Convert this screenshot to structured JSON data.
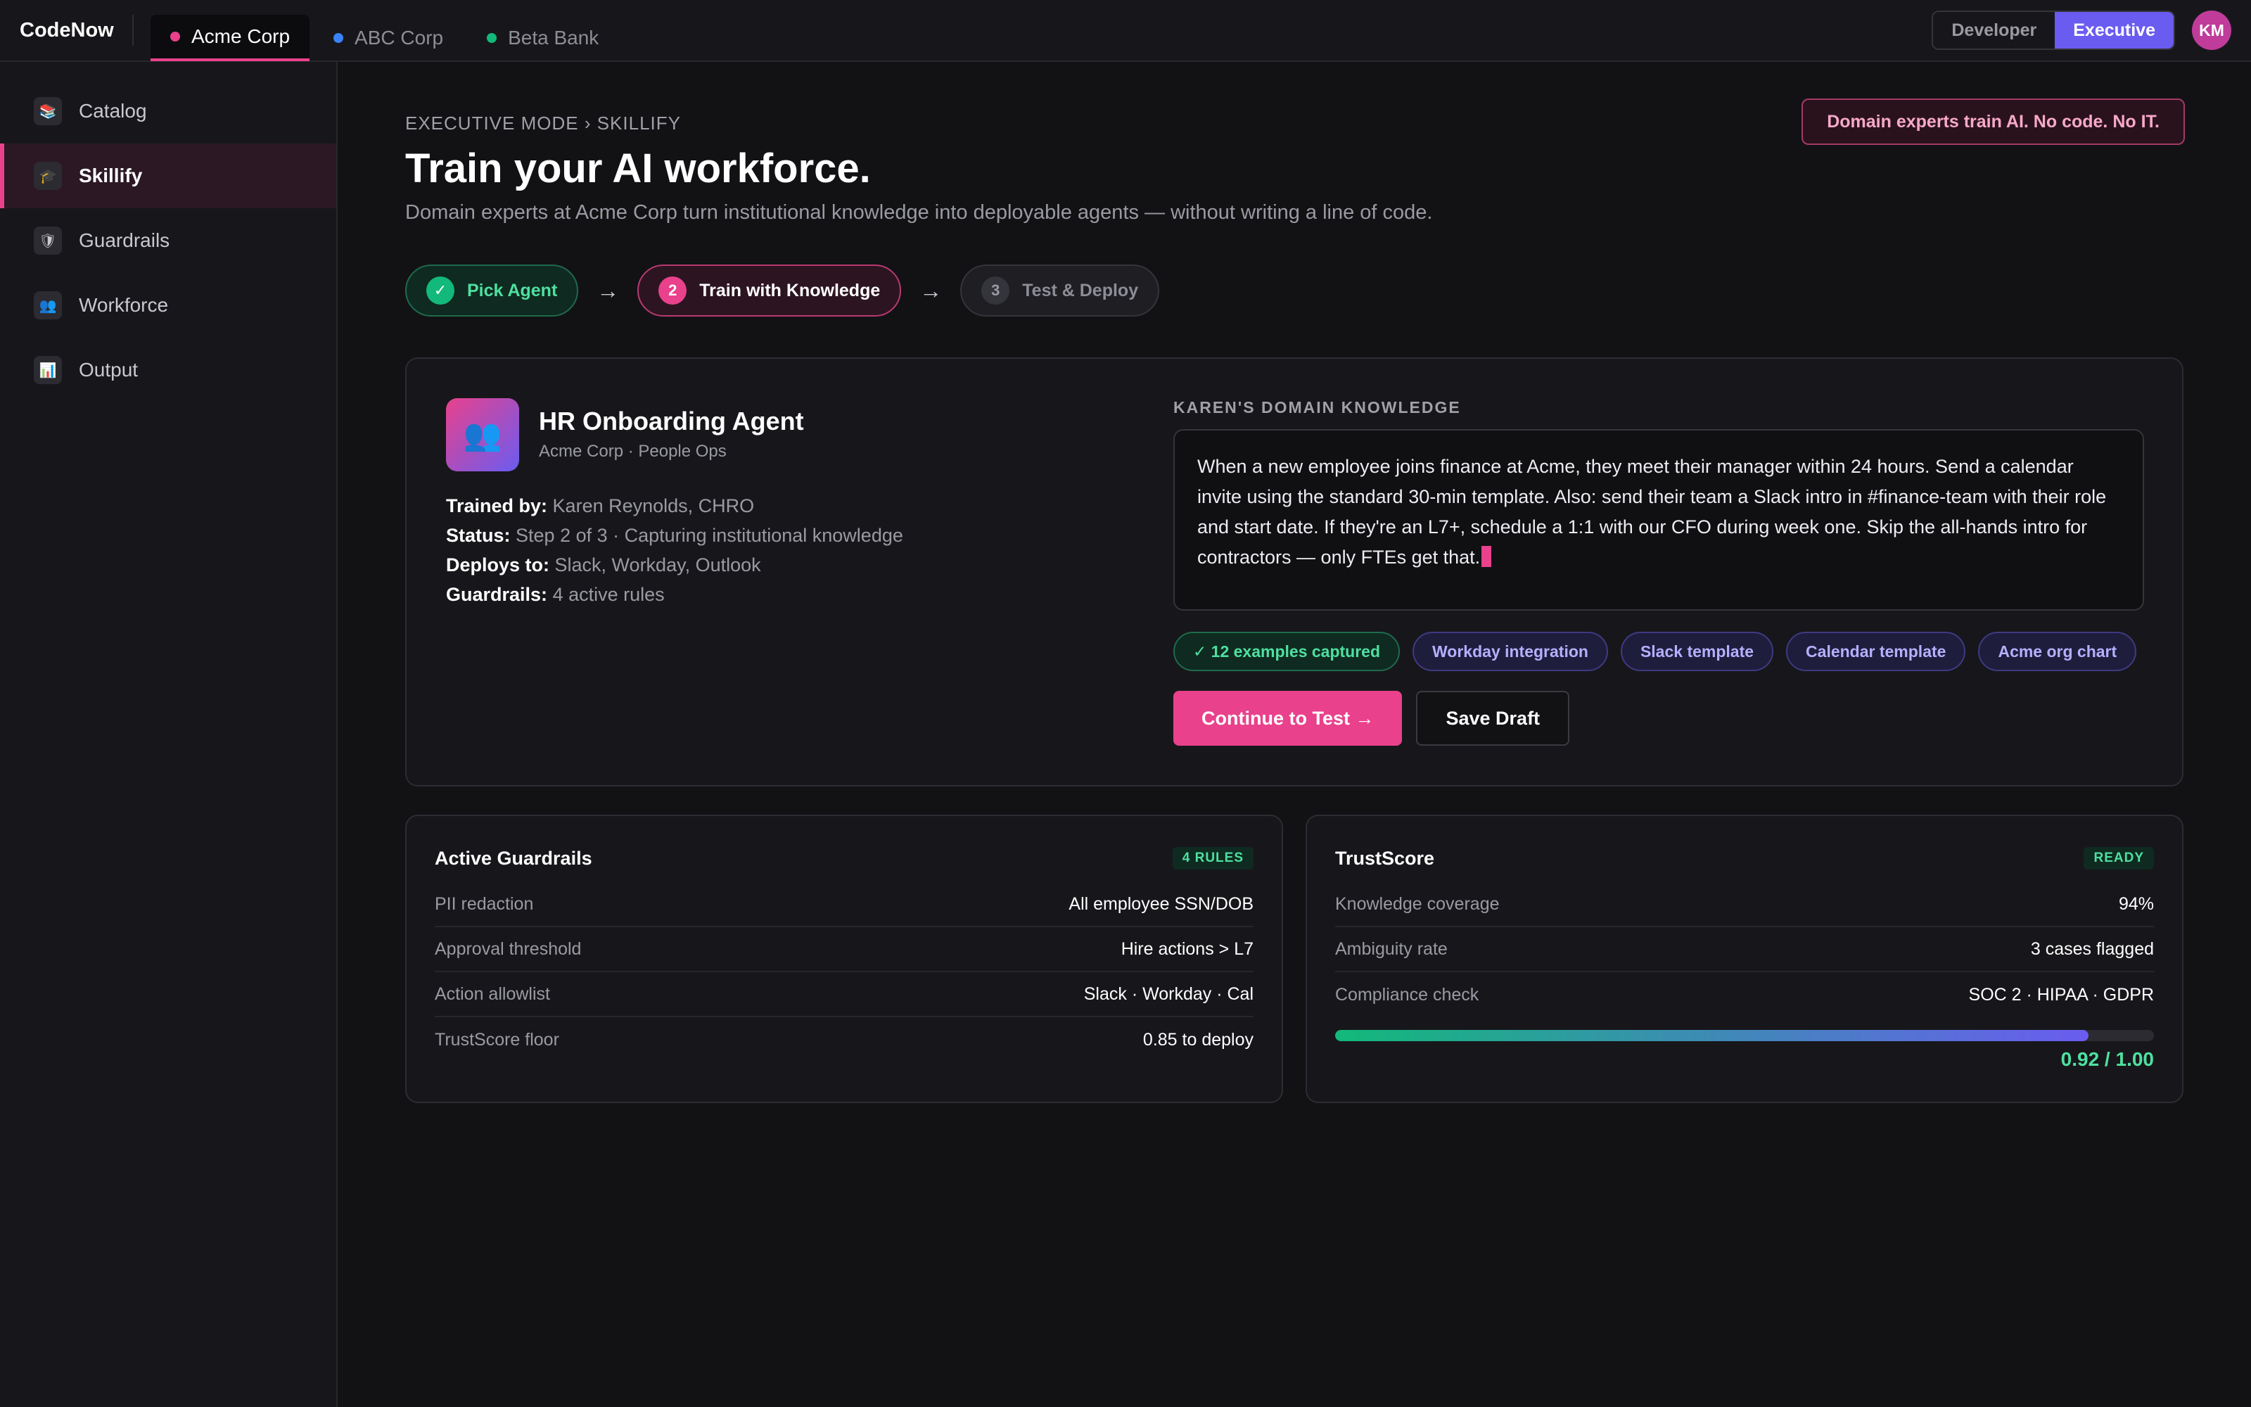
{
  "app": {
    "logo": "CodeNow"
  },
  "tenants": [
    {
      "label": "Acme Corp",
      "color": "#e9418c",
      "active": true
    },
    {
      "label": "ABC Corp",
      "color": "#3b82f6",
      "active": false
    },
    {
      "label": "Beta Bank",
      "color": "#12b97a",
      "active": false
    }
  ],
  "mode": {
    "developer": "Developer",
    "executive": "Executive",
    "selected": "Executive"
  },
  "user": {
    "initials": "KM"
  },
  "sidebar": {
    "items": [
      {
        "label": "Catalog",
        "icon": "books-icon",
        "glyph": "📚",
        "active": false
      },
      {
        "label": "Skillify",
        "icon": "graduation-cap-icon",
        "glyph": "🎓",
        "active": true
      },
      {
        "label": "Guardrails",
        "icon": "shield-icon",
        "glyph": "🛡",
        "active": false
      },
      {
        "label": "Workforce",
        "icon": "people-icon",
        "glyph": "👥",
        "active": false
      },
      {
        "label": "Output",
        "icon": "chart-icon",
        "glyph": "📊",
        "active": false
      }
    ]
  },
  "header": {
    "breadcrumb": "EXECUTIVE MODE › SKILLIFY",
    "title": "Train your AI workforce.",
    "subtitle": "Domain experts at Acme Corp turn institutional knowledge into deployable agents — without writing a line of code.",
    "banner": "Domain experts train AI. No code. No IT."
  },
  "steps": [
    {
      "num": "✓",
      "label": "Pick Agent",
      "state": "done"
    },
    {
      "num": "2",
      "label": "Train with Knowledge",
      "state": "current"
    },
    {
      "num": "3",
      "label": "Test & Deploy",
      "state": "todo"
    }
  ],
  "step_arrow": "→",
  "agent": {
    "glyph": "👥",
    "name": "HR Onboarding Agent",
    "org": "Acme Corp · People Ops",
    "trained_by_label": "Trained by:",
    "trained_by": "Karen Reynolds, CHRO",
    "status_label": "Status:",
    "status": "Step 2 of 3 · Capturing institutional knowledge",
    "deploys_label": "Deploys to:",
    "deploys": "Slack, Workday, Outlook",
    "guardrails_label": "Guardrails:",
    "guardrails": "4 active rules"
  },
  "knowledge": {
    "label": "KAREN'S DOMAIN KNOWLEDGE",
    "text": "When a new employee joins finance at Acme, they meet their manager within 24 hours. Send a calendar invite using the standard 30-min template. Also: send their team a Slack intro in #finance-team with their role and start date. If they're an L7+, schedule a 1:1 with our CFO during week one. Skip the all-hands intro for contractors — only FTEs get that.",
    "chips": [
      {
        "label": "✓ 12 examples captured",
        "style": "green"
      },
      {
        "label": "Workday integration",
        "style": "purple"
      },
      {
        "label": "Slack template",
        "style": "purple"
      },
      {
        "label": "Calendar template",
        "style": "purple"
      },
      {
        "label": "Acme org chart",
        "style": "purple"
      }
    ],
    "continue_label": "Continue to Test →",
    "save_label": "Save Draft"
  },
  "guardrails_panel": {
    "title": "Active Guardrails",
    "badge": "4 RULES",
    "rows": [
      {
        "k": "PII redaction",
        "v": "All employee SSN/DOB"
      },
      {
        "k": "Approval threshold",
        "v": "Hire actions > L7"
      },
      {
        "k": "Action allowlist",
        "v": "Slack · Workday · Cal"
      },
      {
        "k": "TrustScore floor",
        "v": "0.85 to deploy"
      }
    ]
  },
  "trust_panel": {
    "title": "TrustScore",
    "badge": "READY",
    "rows": [
      {
        "k": "Knowledge coverage",
        "v": "94%"
      },
      {
        "k": "Ambiguity rate",
        "v": "3 cases flagged"
      },
      {
        "k": "Compliance check",
        "v": "SOC 2 · HIPAA · GDPR"
      }
    ],
    "score": 0.92,
    "score_label": "0.92 / 1.00"
  }
}
